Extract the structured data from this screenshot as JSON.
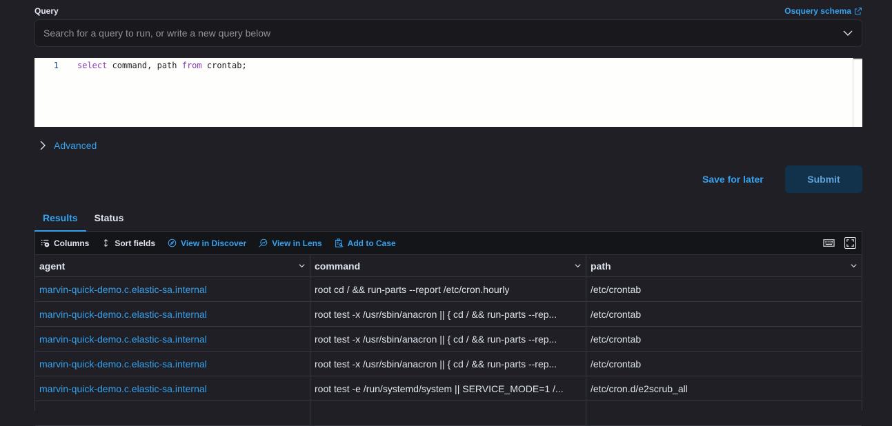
{
  "query": {
    "label": "Query",
    "schema_link": "Osquery schema",
    "search_placeholder": "Search for a query to run, or write a new query below",
    "editor": {
      "line_number": "1",
      "tokens": [
        {
          "text": "select",
          "kind": "keyword"
        },
        {
          "text": " command, path ",
          "kind": "plain"
        },
        {
          "text": "from",
          "kind": "keyword"
        },
        {
          "text": " crontab;",
          "kind": "plain"
        }
      ]
    },
    "advanced_label": "Advanced",
    "save_label": "Save for later",
    "submit_label": "Submit"
  },
  "tabs": [
    {
      "label": "Results",
      "active": true
    },
    {
      "label": "Status",
      "active": false
    }
  ],
  "toolbar": {
    "columns": "Columns",
    "sort_fields": "Sort fields",
    "view_discover": "View in Discover",
    "view_lens": "View in Lens",
    "add_case": "Add to Case"
  },
  "table": {
    "columns": [
      "agent",
      "command",
      "path"
    ],
    "rows": [
      [
        "marvin-quick-demo.c.elastic-sa.internal",
        "root cd / && run-parts --report /etc/cron.hourly",
        "/etc/crontab"
      ],
      [
        "marvin-quick-demo.c.elastic-sa.internal",
        "root test -x /usr/sbin/anacron || { cd / && run-parts --rep...",
        "/etc/crontab"
      ],
      [
        "marvin-quick-demo.c.elastic-sa.internal",
        "root test -x /usr/sbin/anacron || { cd / && run-parts --rep...",
        "/etc/crontab"
      ],
      [
        "marvin-quick-demo.c.elastic-sa.internal",
        "root test -x /usr/sbin/anacron || { cd / && run-parts --rep...",
        "/etc/crontab"
      ],
      [
        "marvin-quick-demo.c.elastic-sa.internal",
        "root test -e /run/systemd/system || SERVICE_MODE=1 /...",
        "/etc/cron.d/e2scrub_all"
      ],
      [
        "",
        "",
        ""
      ]
    ]
  },
  "colors": {
    "accent": "#36a2ef",
    "background": "#1f1f25",
    "submit_bg": "#12324b"
  }
}
